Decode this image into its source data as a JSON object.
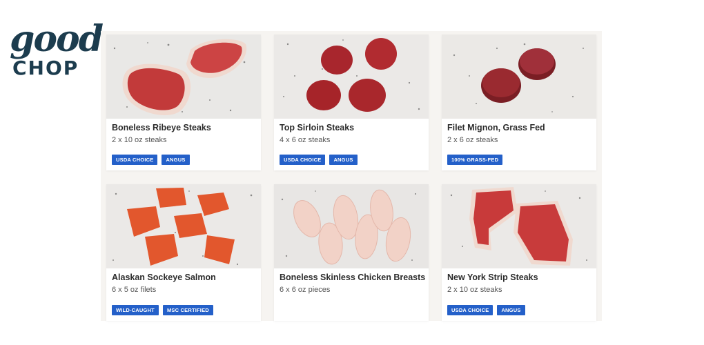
{
  "brand": {
    "logo_top": "good",
    "logo_bottom": "CHOP",
    "color": "#1c3c4e"
  },
  "accent_color": "#2460c9",
  "products": [
    {
      "name": "Boneless Ribeye Steaks",
      "portion": "2 x 10 oz steaks",
      "badges": [
        "USDA CHOICE",
        "ANGUS"
      ],
      "image": "ribeye-steaks"
    },
    {
      "name": "Top Sirloin Steaks",
      "portion": "4 x 6 oz steaks",
      "badges": [
        "USDA CHOICE",
        "ANGUS"
      ],
      "image": "sirloin-steaks"
    },
    {
      "name": "Filet Mignon, Grass Fed",
      "portion": "2 x 6 oz steaks",
      "badges": [
        "100% GRASS-FED"
      ],
      "image": "filet-mignon"
    },
    {
      "name": "Alaskan Sockeye Salmon",
      "portion": "6 x 5 oz filets",
      "badges": [
        "WILD-CAUGHT",
        "MSC CERTIFIED"
      ],
      "image": "salmon-filets"
    },
    {
      "name": "Boneless Skinless Chicken Breasts",
      "portion": "6 x 6 oz pieces",
      "badges": [],
      "image": "chicken-breasts"
    },
    {
      "name": "New York Strip Steaks",
      "portion": "2 x 10 oz steaks",
      "badges": [
        "USDA CHOICE",
        "ANGUS"
      ],
      "image": "strip-steaks"
    }
  ]
}
